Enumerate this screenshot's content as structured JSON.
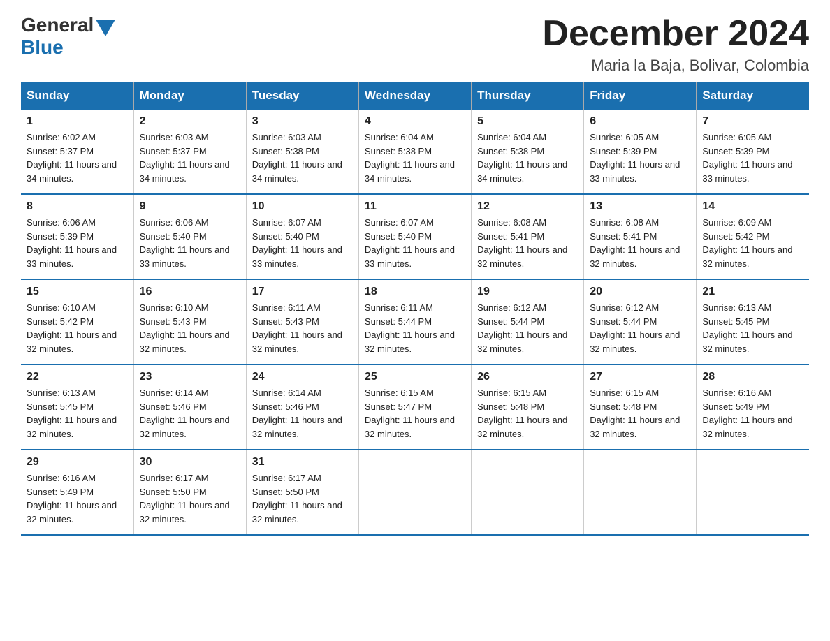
{
  "header": {
    "logo": {
      "general": "General",
      "blue": "Blue"
    },
    "title": "December 2024",
    "location": "Maria la Baja, Bolivar, Colombia"
  },
  "weekdays": [
    "Sunday",
    "Monday",
    "Tuesday",
    "Wednesday",
    "Thursday",
    "Friday",
    "Saturday"
  ],
  "weeks": [
    [
      {
        "day": "1",
        "sunrise": "6:02 AM",
        "sunset": "5:37 PM",
        "daylight": "11 hours and 34 minutes."
      },
      {
        "day": "2",
        "sunrise": "6:03 AM",
        "sunset": "5:37 PM",
        "daylight": "11 hours and 34 minutes."
      },
      {
        "day": "3",
        "sunrise": "6:03 AM",
        "sunset": "5:38 PM",
        "daylight": "11 hours and 34 minutes."
      },
      {
        "day": "4",
        "sunrise": "6:04 AM",
        "sunset": "5:38 PM",
        "daylight": "11 hours and 34 minutes."
      },
      {
        "day": "5",
        "sunrise": "6:04 AM",
        "sunset": "5:38 PM",
        "daylight": "11 hours and 34 minutes."
      },
      {
        "day": "6",
        "sunrise": "6:05 AM",
        "sunset": "5:39 PM",
        "daylight": "11 hours and 33 minutes."
      },
      {
        "day": "7",
        "sunrise": "6:05 AM",
        "sunset": "5:39 PM",
        "daylight": "11 hours and 33 minutes."
      }
    ],
    [
      {
        "day": "8",
        "sunrise": "6:06 AM",
        "sunset": "5:39 PM",
        "daylight": "11 hours and 33 minutes."
      },
      {
        "day": "9",
        "sunrise": "6:06 AM",
        "sunset": "5:40 PM",
        "daylight": "11 hours and 33 minutes."
      },
      {
        "day": "10",
        "sunrise": "6:07 AM",
        "sunset": "5:40 PM",
        "daylight": "11 hours and 33 minutes."
      },
      {
        "day": "11",
        "sunrise": "6:07 AM",
        "sunset": "5:40 PM",
        "daylight": "11 hours and 33 minutes."
      },
      {
        "day": "12",
        "sunrise": "6:08 AM",
        "sunset": "5:41 PM",
        "daylight": "11 hours and 32 minutes."
      },
      {
        "day": "13",
        "sunrise": "6:08 AM",
        "sunset": "5:41 PM",
        "daylight": "11 hours and 32 minutes."
      },
      {
        "day": "14",
        "sunrise": "6:09 AM",
        "sunset": "5:42 PM",
        "daylight": "11 hours and 32 minutes."
      }
    ],
    [
      {
        "day": "15",
        "sunrise": "6:10 AM",
        "sunset": "5:42 PM",
        "daylight": "11 hours and 32 minutes."
      },
      {
        "day": "16",
        "sunrise": "6:10 AM",
        "sunset": "5:43 PM",
        "daylight": "11 hours and 32 minutes."
      },
      {
        "day": "17",
        "sunrise": "6:11 AM",
        "sunset": "5:43 PM",
        "daylight": "11 hours and 32 minutes."
      },
      {
        "day": "18",
        "sunrise": "6:11 AM",
        "sunset": "5:44 PM",
        "daylight": "11 hours and 32 minutes."
      },
      {
        "day": "19",
        "sunrise": "6:12 AM",
        "sunset": "5:44 PM",
        "daylight": "11 hours and 32 minutes."
      },
      {
        "day": "20",
        "sunrise": "6:12 AM",
        "sunset": "5:44 PM",
        "daylight": "11 hours and 32 minutes."
      },
      {
        "day": "21",
        "sunrise": "6:13 AM",
        "sunset": "5:45 PM",
        "daylight": "11 hours and 32 minutes."
      }
    ],
    [
      {
        "day": "22",
        "sunrise": "6:13 AM",
        "sunset": "5:45 PM",
        "daylight": "11 hours and 32 minutes."
      },
      {
        "day": "23",
        "sunrise": "6:14 AM",
        "sunset": "5:46 PM",
        "daylight": "11 hours and 32 minutes."
      },
      {
        "day": "24",
        "sunrise": "6:14 AM",
        "sunset": "5:46 PM",
        "daylight": "11 hours and 32 minutes."
      },
      {
        "day": "25",
        "sunrise": "6:15 AM",
        "sunset": "5:47 PM",
        "daylight": "11 hours and 32 minutes."
      },
      {
        "day": "26",
        "sunrise": "6:15 AM",
        "sunset": "5:48 PM",
        "daylight": "11 hours and 32 minutes."
      },
      {
        "day": "27",
        "sunrise": "6:15 AM",
        "sunset": "5:48 PM",
        "daylight": "11 hours and 32 minutes."
      },
      {
        "day": "28",
        "sunrise": "6:16 AM",
        "sunset": "5:49 PM",
        "daylight": "11 hours and 32 minutes."
      }
    ],
    [
      {
        "day": "29",
        "sunrise": "6:16 AM",
        "sunset": "5:49 PM",
        "daylight": "11 hours and 32 minutes."
      },
      {
        "day": "30",
        "sunrise": "6:17 AM",
        "sunset": "5:50 PM",
        "daylight": "11 hours and 32 minutes."
      },
      {
        "day": "31",
        "sunrise": "6:17 AM",
        "sunset": "5:50 PM",
        "daylight": "11 hours and 32 minutes."
      },
      null,
      null,
      null,
      null
    ]
  ]
}
